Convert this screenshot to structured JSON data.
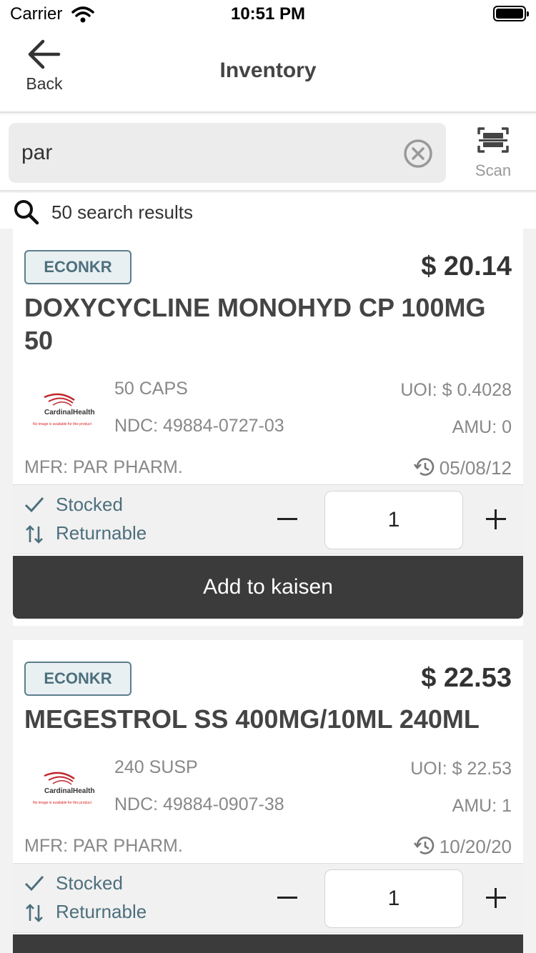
{
  "status_bar": {
    "carrier": "Carrier",
    "time": "10:51 PM"
  },
  "nav": {
    "back_label": "Back",
    "title": "Inventory"
  },
  "search": {
    "value": "par",
    "scan_label": "Scan",
    "results": "50 search results"
  },
  "logo": {
    "brand": "CardinalHealth",
    "note": "No image is available for this product"
  },
  "items": [
    {
      "badge": "ECONKR",
      "price": "$ 20.14",
      "title": "DOXYCYCLINE MONOHYD CP 100MG 50",
      "package": "50 CAPS",
      "ndc": "NDC: 49884-0727-03",
      "uoi": "UOI: $ 0.4028",
      "amu": "AMU: 0",
      "mfr": "MFR: PAR PHARM.",
      "date": "05/08/12",
      "stocked": "Stocked",
      "returnable": "Returnable",
      "quantity": "1",
      "add_label": "Add to kaisen"
    },
    {
      "badge": "ECONKR",
      "price": "$ 22.53",
      "title": "MEGESTROL SS 400MG/10ML 240ML",
      "package": "240 SUSP",
      "ndc": "NDC: 49884-0907-38",
      "uoi": "UOI: $ 22.53",
      "amu": "AMU: 1",
      "mfr": "MFR: PAR PHARM.",
      "date": "10/20/20",
      "stocked": "Stocked",
      "returnable": "Returnable",
      "quantity": "1"
    }
  ],
  "colors": {
    "accent": "#4d6f7d",
    "button": "#3b3b3b",
    "background": "#f2f2f2"
  }
}
